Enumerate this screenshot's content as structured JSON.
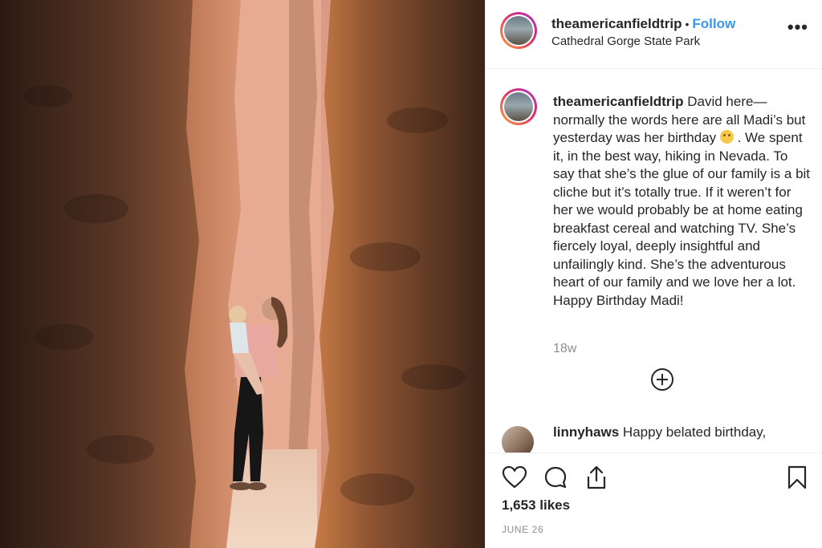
{
  "post": {
    "username": "theamericanfieldtrip",
    "separator": "•",
    "follow_label": "Follow",
    "location": "Cathedral Gorge State Park",
    "more_label": "•••"
  },
  "caption": {
    "username": "theamericanfieldtrip",
    "text_before_emoji": "David here—normally the words here are all Madi’s but yesterday was her birthday ",
    "text_after_emoji": " . We spent it, in the best way, hiking in Nevada. To say that she’s the glue of our family is a bit cliche but it’s totally true. If it weren’t for her we would probably be at home eating breakfast cereal and watching TV. She’s fiercely loyal, deeply insightful and unfailingly kind. She’s the adventurous heart of our family and we love her a lot. Happy Birthday Madi!",
    "time": "18w"
  },
  "comments": [
    {
      "username": "linnyhaws",
      "text": "Happy belated birthday,"
    }
  ],
  "footer": {
    "likes": "1,653 likes",
    "date": "JUNE 26"
  },
  "icons": {
    "like": "heart-icon",
    "comment": "comment-icon",
    "share": "share-icon",
    "save": "bookmark-icon",
    "load_more": "plus-circle-icon"
  },
  "colors": {
    "follow": "#3897f0",
    "muted": "#8e8e8e",
    "text": "#262626"
  }
}
